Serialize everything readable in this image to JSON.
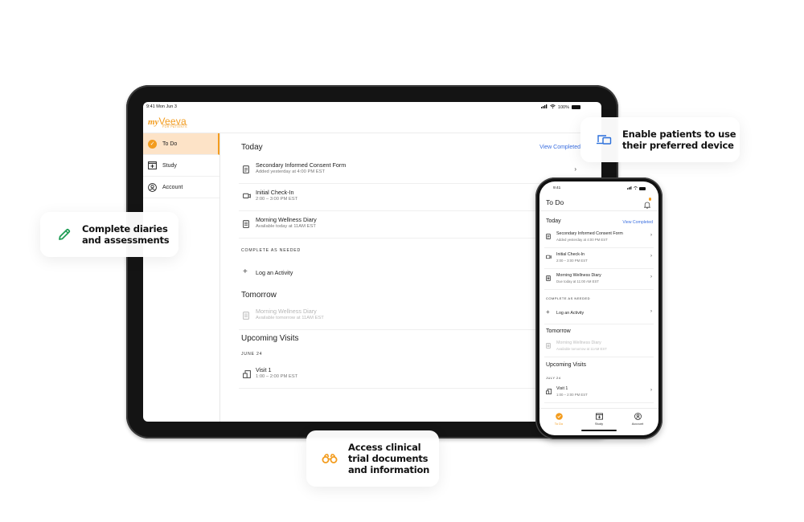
{
  "tablet": {
    "status": {
      "time": "9:41 Mon Jun 3",
      "battery": "100%"
    },
    "brand": {
      "prefix": "my",
      "name": "Veeva",
      "tagline": "FOR PATIENTS",
      "color": "#f39c1e"
    },
    "sidebar": {
      "items": [
        {
          "label": "To Do",
          "icon": "check-circle-icon",
          "active": true
        },
        {
          "label": "Study",
          "icon": "study-icon",
          "active": false
        },
        {
          "label": "Account",
          "icon": "account-icon",
          "active": false
        }
      ]
    },
    "today": {
      "heading": "Today",
      "view_completed": "View Completed",
      "items": [
        {
          "title": "Secondary Informed Consent Form",
          "subtitle": "Added yesterday at 4:00 PM EST",
          "icon": "document-icon"
        },
        {
          "title": "Initial Check-In",
          "subtitle": "2:00 – 3:00 PM EST",
          "icon": "video-icon"
        },
        {
          "title": "Morning Wellness Diary",
          "subtitle": "Available today at 11AM EST",
          "icon": "diary-icon"
        }
      ]
    },
    "as_needed": {
      "caption": "COMPLETE AS NEEDED",
      "item": "Log an Activity"
    },
    "tomorrow": {
      "heading": "Tomorrow",
      "items": [
        {
          "title": "Morning Wellness Diary",
          "subtitle": "Available tomorrow at 11AM EST"
        }
      ]
    },
    "visits": {
      "heading": "Upcoming Visits",
      "date": "JUNE 24",
      "items": [
        {
          "title": "Visit 1",
          "subtitle": "1:00 – 2:00 PM EST"
        }
      ]
    }
  },
  "phone": {
    "status": {
      "time": "9:41"
    },
    "title": "To Do",
    "today": {
      "heading": "Today",
      "view_completed": "View Completed",
      "items": [
        {
          "title": "Secondary Informed Consent Form",
          "subtitle": "Added yesterday at 4:00 PM EST"
        },
        {
          "title": "Initial Check-In",
          "subtitle": "2:00 – 3:00 PM EST"
        },
        {
          "title": "Morning Wellness Diary",
          "subtitle": "Due today at 11:00 AM EST"
        }
      ]
    },
    "as_needed": {
      "caption": "COMPLETE AS NEEDED",
      "item": "Log an Activity"
    },
    "tomorrow": {
      "heading": "Tomorrow",
      "items": [
        {
          "title": "Morning Wellness Diary",
          "subtitle": "Available tomorrow at 11AM EST"
        }
      ]
    },
    "visits": {
      "heading": "Upcoming Visits",
      "date": "JULY 24",
      "items": [
        {
          "title": "Visit 1",
          "subtitle": "1:00 – 2:00 PM EST"
        }
      ]
    },
    "tabbar": [
      {
        "label": "To Do",
        "active": true
      },
      {
        "label": "Study",
        "active": false
      },
      {
        "label": "Account",
        "active": false
      }
    ]
  },
  "callouts": {
    "diaries": {
      "line1": "Complete diaries",
      "line2": "and assessments",
      "icon": "pencil-icon",
      "color": "#1f9d55"
    },
    "device": {
      "line1": "Enable patients to use",
      "line2": "their preferred device",
      "icon": "devices-icon",
      "color": "#2a6fdb"
    },
    "access": {
      "line1": "Access clinical",
      "line2": "trial documents",
      "line3": "and information",
      "icon": "binoculars-icon",
      "color": "#f39c1e"
    }
  }
}
